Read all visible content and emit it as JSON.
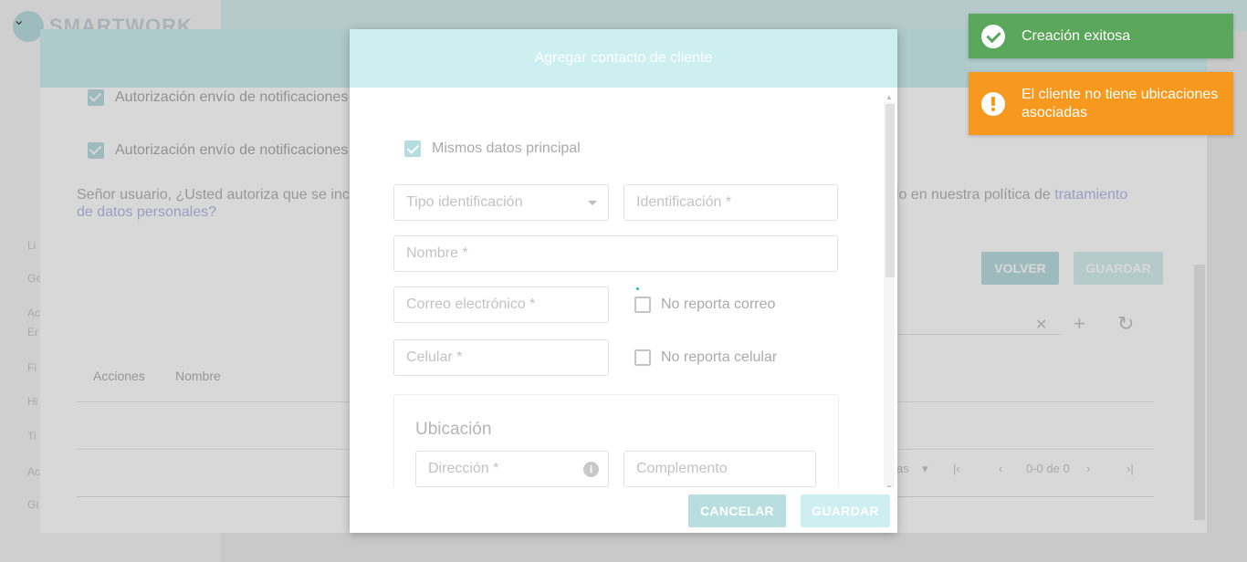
{
  "background": {
    "logo_text": "SMARTWORK",
    "auth_checkbox_1": "Autorización envío de notificaciones",
    "auth_checkbox_2": "Autorización envío de notificaciones",
    "privacy_text_start": "Señor usuario, ¿Usted autoriza que se inclu",
    "privacy_text_mid": "ido en nuestra política de ",
    "privacy_link_1": "tratamiento",
    "privacy_link_2": "de datos personales?",
    "side_labels": [
      "Li",
      "Ge",
      "Ac",
      "Er",
      "Fi",
      "Hi",
      "Ti",
      "Ac",
      "Gi"
    ],
    "back_button": "VOLVER",
    "save_button": "GUARDAR",
    "table_headers": [
      "Acciones",
      "Nombre"
    ],
    "pager_label": "as",
    "pager_range": "0-0 de 0"
  },
  "modal": {
    "title": "Agregar contacto de cliente",
    "same_data_label": "Mismos datos principal",
    "fields": {
      "id_type": "Tipo identificación",
      "identification": "Identificación *",
      "name": "Nombre *",
      "email": "Correo electrónico *",
      "phone": "Celular *",
      "address": "Dirección *",
      "complement": "Complemento"
    },
    "no_email_label": "No reporta correo",
    "no_phone_label": "No reporta celular",
    "location_section_title": "Ubicación",
    "cancel_button": "CANCELAR",
    "save_button": "GUARDAR"
  },
  "toasts": {
    "success": "Creación exitosa",
    "warning": "El cliente no tiene ubicaciones asociadas"
  },
  "colors": {
    "success": "#5aa65a",
    "warning": "#f7991e",
    "accent_teal_light": "#cdeff0"
  }
}
